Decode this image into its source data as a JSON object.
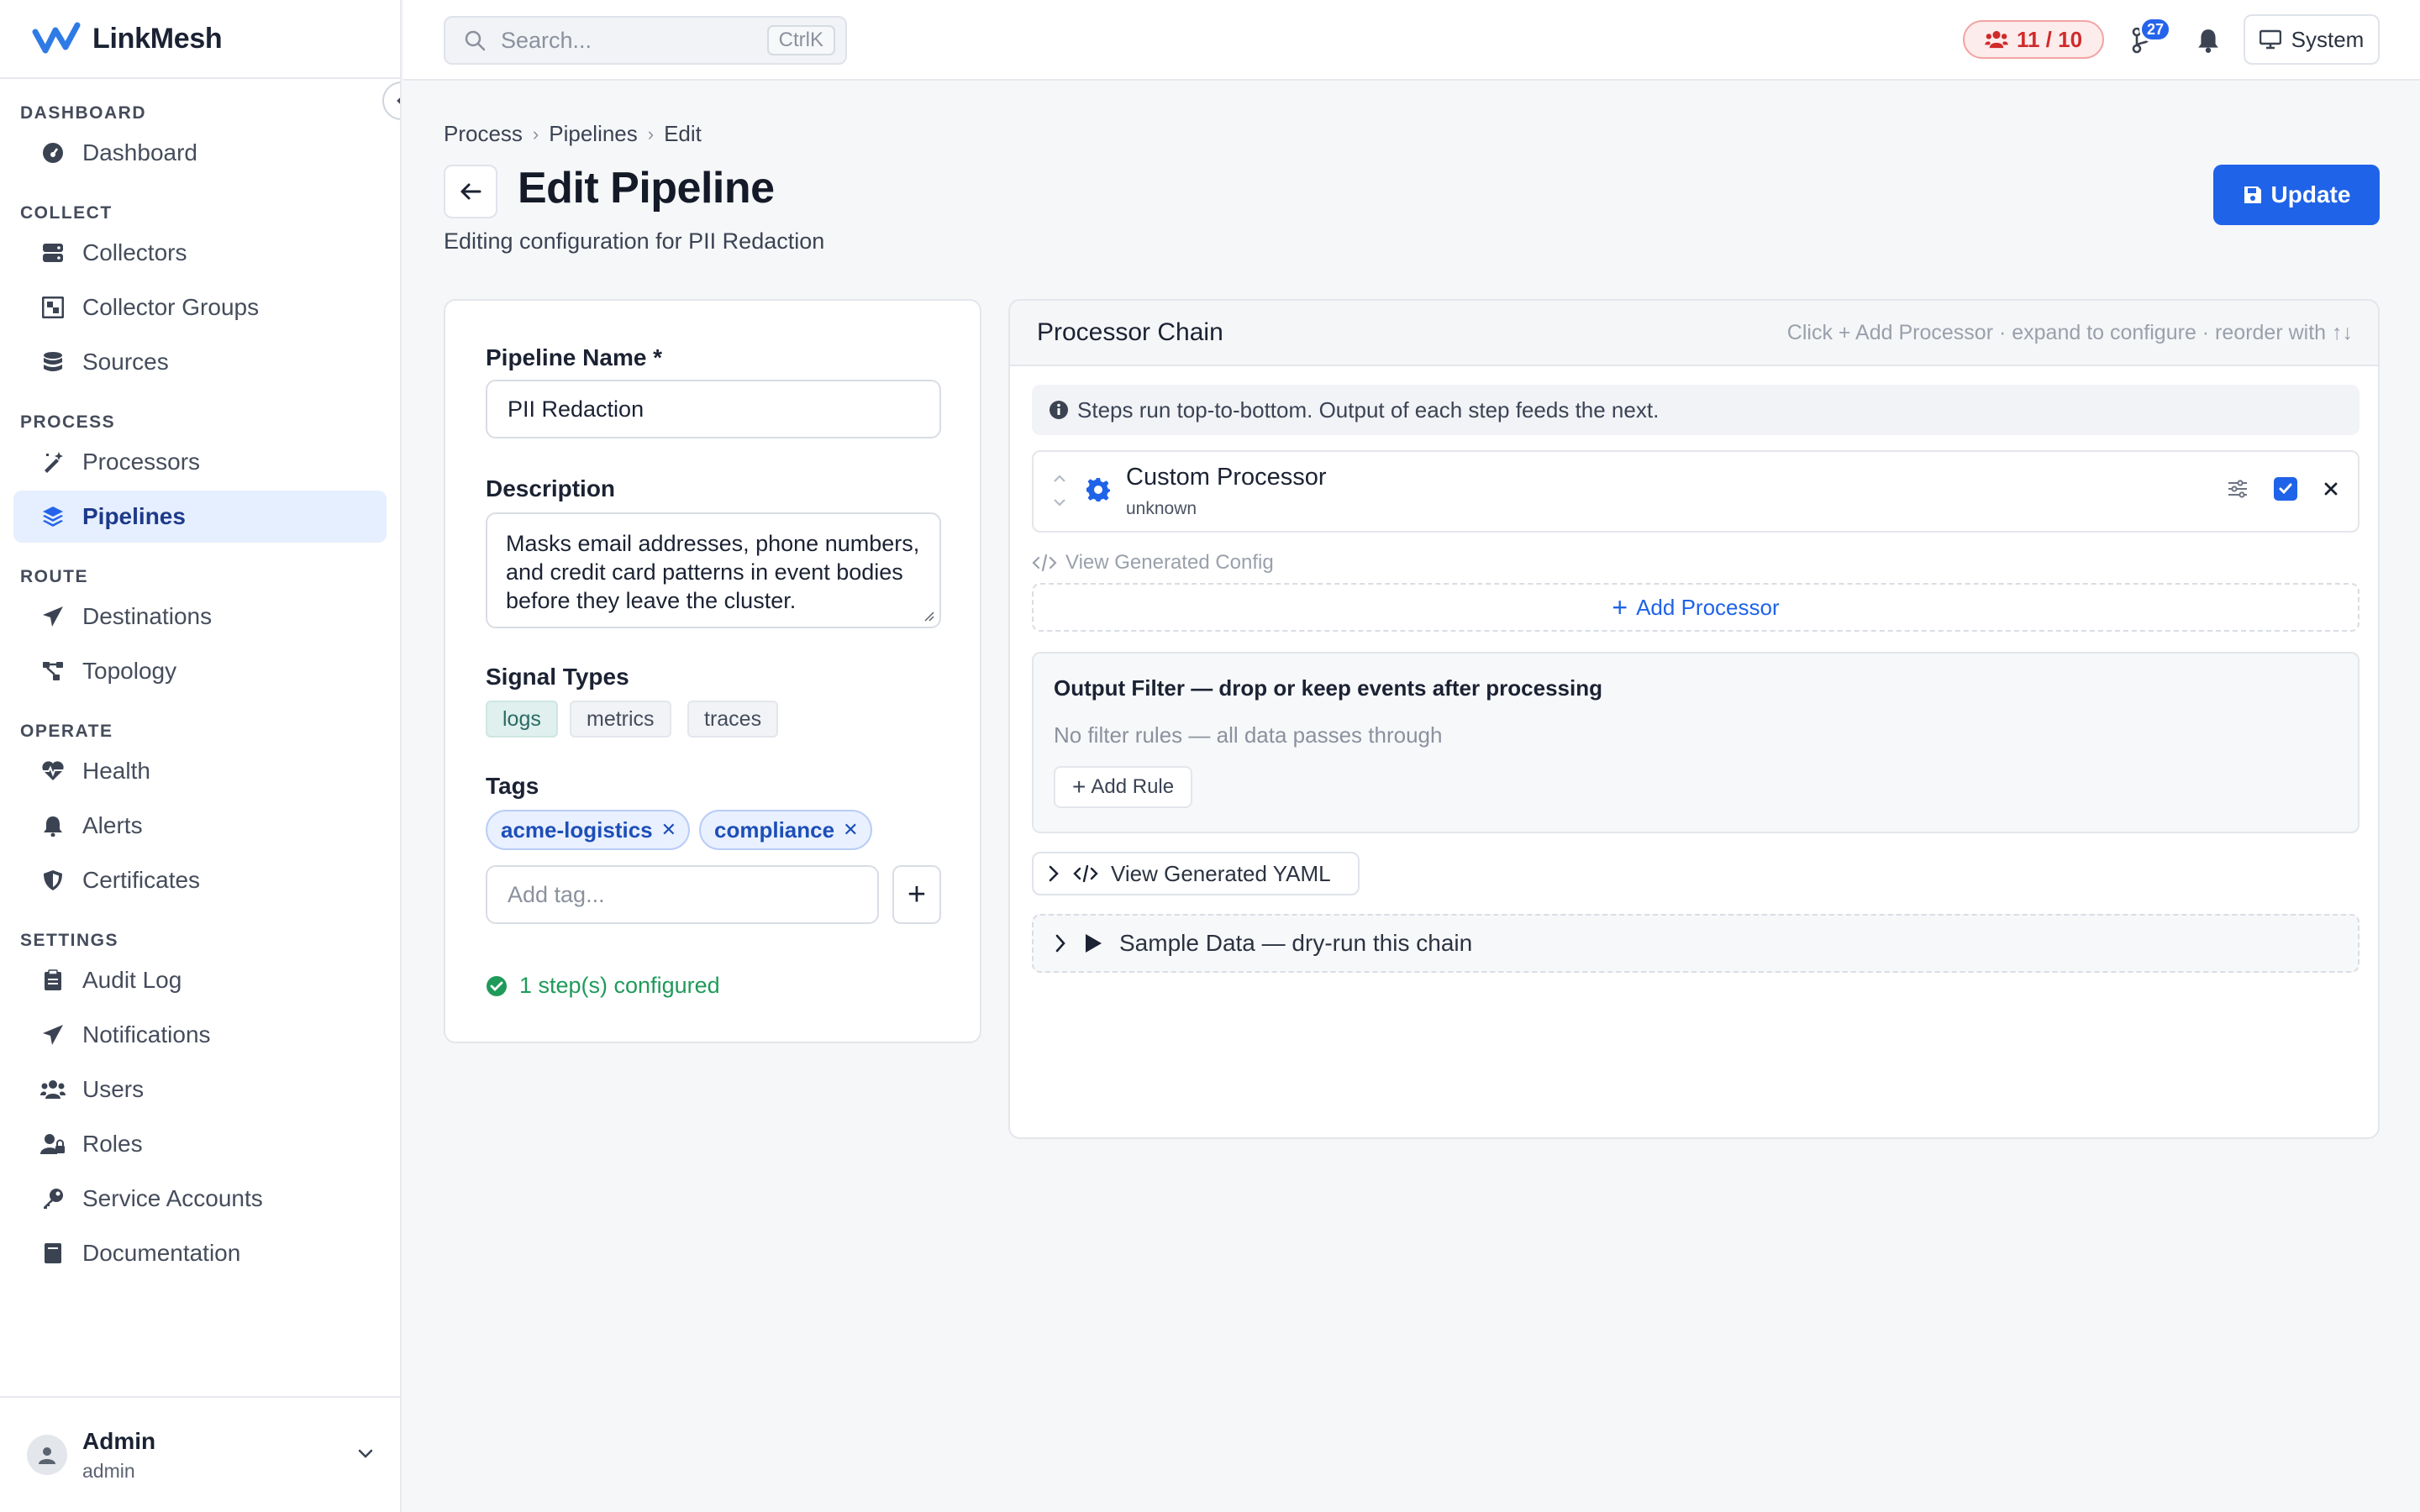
{
  "app": {
    "name": "LinkMesh"
  },
  "sidebar": {
    "sections": [
      {
        "title": "DASHBOARD",
        "items": [
          {
            "label": "Dashboard",
            "icon": "dashboard-icon"
          }
        ]
      },
      {
        "title": "COLLECT",
        "items": [
          {
            "label": "Collectors",
            "icon": "server-icon"
          },
          {
            "label": "Collector Groups",
            "icon": "group-icon"
          },
          {
            "label": "Sources",
            "icon": "database-icon"
          }
        ]
      },
      {
        "title": "PROCESS",
        "items": [
          {
            "label": "Processors",
            "icon": "wand-icon"
          },
          {
            "label": "Pipelines",
            "icon": "layers-icon",
            "active": true
          }
        ]
      },
      {
        "title": "ROUTE",
        "items": [
          {
            "label": "Destinations",
            "icon": "send-icon"
          },
          {
            "label": "Topology",
            "icon": "topology-icon"
          }
        ]
      },
      {
        "title": "OPERATE",
        "items": [
          {
            "label": "Health",
            "icon": "heartbeat-icon"
          },
          {
            "label": "Alerts",
            "icon": "bell-icon"
          },
          {
            "label": "Certificates",
            "icon": "shield-icon"
          }
        ]
      },
      {
        "title": "SETTINGS",
        "items": [
          {
            "label": "Audit Log",
            "icon": "clipboard-icon"
          },
          {
            "label": "Notifications",
            "icon": "send-icon"
          },
          {
            "label": "Users",
            "icon": "users-icon"
          },
          {
            "label": "Roles",
            "icon": "user-lock-icon"
          },
          {
            "label": "Service Accounts",
            "icon": "key-icon"
          },
          {
            "label": "Documentation",
            "icon": "book-icon"
          }
        ]
      }
    ],
    "user": {
      "name": "Admin",
      "role": "admin"
    }
  },
  "topbar": {
    "search_placeholder": "Search...",
    "search_shortcut": "CtrlK",
    "usage": "11 / 10",
    "pending_count": "27",
    "theme_label": "System"
  },
  "header": {
    "breadcrumb": [
      "Process",
      "Pipelines",
      "Edit"
    ],
    "title": "Edit Pipeline",
    "subtitle": "Editing configuration for PII Redaction",
    "update_label": "Update"
  },
  "form": {
    "name_label": "Pipeline Name *",
    "name_value": "PII Redaction",
    "description_label": "Description",
    "description_value": "Masks email addresses, phone numbers, and credit card patterns in event bodies before they leave the cluster.",
    "signal_types_label": "Signal Types",
    "signal_types": [
      {
        "label": "logs",
        "selected": true
      },
      {
        "label": "metrics",
        "selected": false
      },
      {
        "label": "traces",
        "selected": false
      }
    ],
    "tags_label": "Tags",
    "tags": [
      "acme-logistics",
      "compliance"
    ],
    "tag_placeholder": "Add tag...",
    "status": "1 step(s) configured"
  },
  "chain": {
    "title": "Processor Chain",
    "hint": "Click + Add Processor · expand to configure · reorder with ↑↓",
    "info": "Steps run top-to-bottom. Output of each step feeds the next.",
    "processors": [
      {
        "name": "Custom Processor",
        "type": "unknown",
        "enabled": true
      }
    ],
    "view_config_label": "View Generated Config",
    "add_processor_label": "Add Processor",
    "filter": {
      "title": "Output Filter — drop or keep events after processing",
      "empty": "No filter rules — all data passes through",
      "add_rule_label": "Add Rule"
    },
    "yaml_label": "View Generated YAML",
    "sample_label": "Sample Data — dry-run this chain"
  },
  "colors": {
    "accent": "#1f63e8",
    "danger": "#d12a2a",
    "success": "#1f9a5a"
  }
}
